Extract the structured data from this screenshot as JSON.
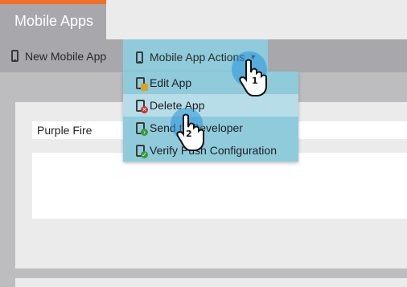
{
  "tab": {
    "label": "Mobile Apps"
  },
  "colors": {
    "accent": "#f36f22",
    "menu_bg": "#8fcbdb",
    "menu_hover": "#b7dde8",
    "cursor_glow": "#2896dc"
  },
  "toolbar": {
    "new_label": "New Mobile App",
    "actions_label": "Mobile App Actions"
  },
  "menu": {
    "items": [
      {
        "label": "Edit App",
        "icon": "edit-phone-icon"
      },
      {
        "label": "Delete App",
        "icon": "delete-phone-icon"
      },
      {
        "label": "Send to Developer",
        "icon": "send-phone-icon"
      },
      {
        "label": "Verify Push Configuration",
        "icon": "verify-phone-icon"
      }
    ]
  },
  "form": {
    "app_name": "Purple Fire"
  },
  "steps": {
    "one": "1",
    "two": "2"
  }
}
